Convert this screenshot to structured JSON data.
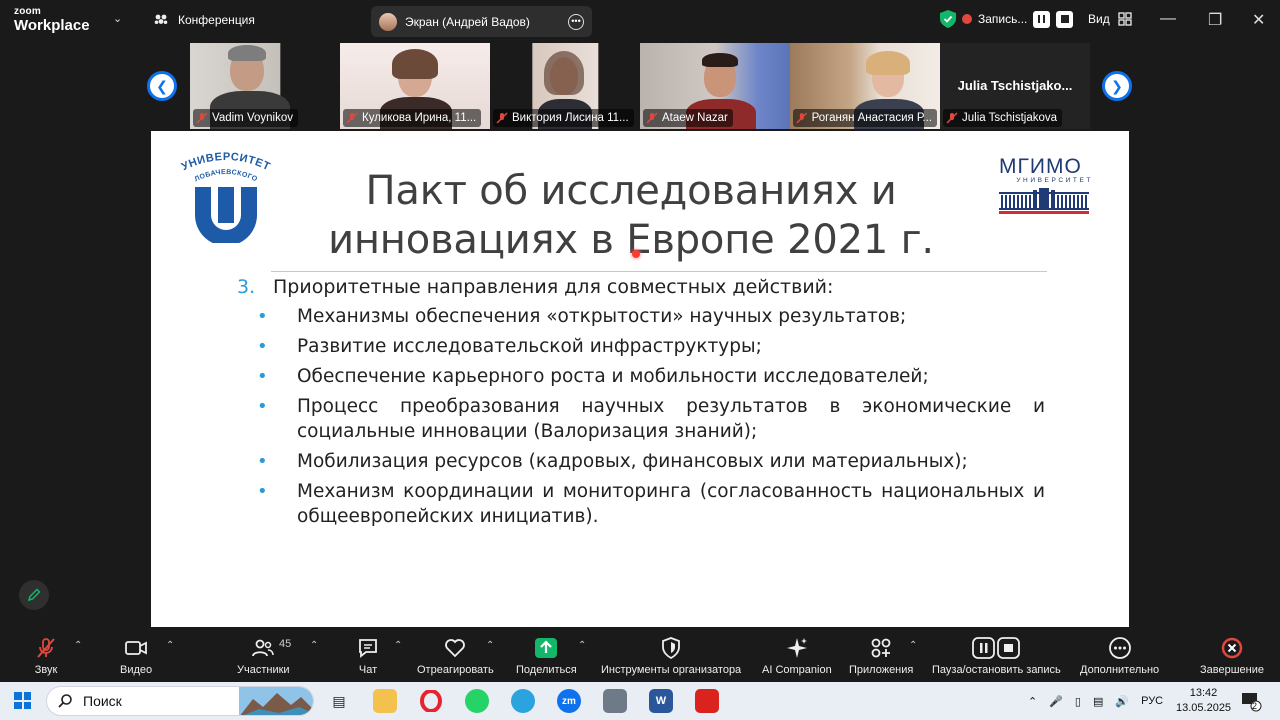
{
  "app": {
    "logo_top": "zoom",
    "logo_bottom": "Workplace",
    "meeting_label": "Конференция",
    "screen_share_label": "Экран (Андрей Вадов)",
    "recording_label": "Запись...",
    "view_label": "Вид"
  },
  "participants": [
    {
      "name": "Vadim Voynikov"
    },
    {
      "name": "Куликова Ирина, 11..."
    },
    {
      "name": "Виктория Лисина 11..."
    },
    {
      "name": "Ataew Nazar"
    },
    {
      "name": "Роганян Анастасия Р..."
    },
    {
      "name": "Julia Tschistjakova",
      "display": "Julia  Tschistjako..."
    }
  ],
  "slide": {
    "left_logo_text_top": "УНИВЕРСИТЕТ",
    "left_logo_text_bottom": "ЛОБАЧЕВСКОГО",
    "right_logo_top": "МГИМО",
    "right_logo_bottom": "УНИВЕРСИТЕТ",
    "title_line1": "Пакт об исследованиях и",
    "title_line2": "инновациях в Европе 2021 г.",
    "lead_number": "3.",
    "lead_text": "Приоритетные направления для совместных действий:",
    "bullets": [
      "Механизмы обеспечения «открытости» научных результатов;",
      "Развитие исследовательской инфраструктуры;",
      "Обеспечение карьерного роста и мобильности исследователей;",
      "Процесс преобразования научных результатов в экономические и социальные инновации (Валоризация знаний);",
      "Мобилизация ресурсов (кадровых, финансовых или материальных);",
      "Механизм координации и мониторинга (согласованность национальных и общеевропейских инициатив)."
    ]
  },
  "toolbar": {
    "audio": "Звук",
    "video": "Видео",
    "participants": "Участники",
    "participants_count": "45",
    "chat": "Чат",
    "react": "Отреагировать",
    "share": "Поделиться",
    "host_tools": "Инструменты организатора",
    "ai": "AI Companion",
    "apps": "Приложения",
    "pause_record": "Пауза/остановить запись",
    "more": "Дополнительно",
    "end": "Завершение"
  },
  "taskbar": {
    "search_placeholder": "Поиск",
    "language": "РУС",
    "time": "13:42",
    "date": "13.05.2025",
    "notif_count": "2"
  },
  "colors": {
    "zoom_blue": "#0e72ed",
    "share_green": "#12b76a",
    "end_red": "#e0483e",
    "slide_accent": "#2b9ad8"
  }
}
